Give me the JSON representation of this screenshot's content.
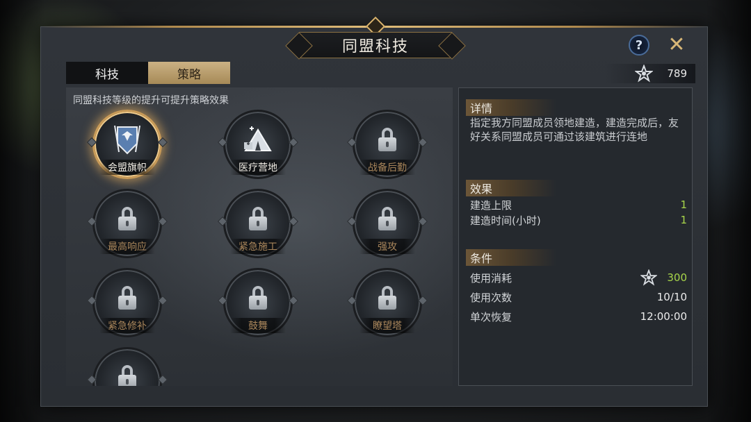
{
  "title": "同盟科技",
  "tabs": [
    {
      "label": "科技",
      "active": false
    },
    {
      "label": "策略",
      "active": true
    }
  ],
  "currency": {
    "icon": "alliance-star-icon",
    "amount": "789"
  },
  "hint": "同盟科技等级的提升可提升策略效果",
  "nodes": [
    {
      "label": "会盟旗帜",
      "state": "selected",
      "icon": "alliance-banner-icon"
    },
    {
      "label": "医疗营地",
      "state": "unlocked",
      "icon": "medical-camp-icon"
    },
    {
      "label": "战备后勤",
      "state": "locked",
      "icon": "lock-icon"
    },
    {
      "label": "最高响应",
      "state": "locked",
      "icon": "lock-icon"
    },
    {
      "label": "紧急施工",
      "state": "locked",
      "icon": "lock-icon"
    },
    {
      "label": "强攻",
      "state": "locked",
      "icon": "lock-icon"
    },
    {
      "label": "紧急修补",
      "state": "locked",
      "icon": "lock-icon"
    },
    {
      "label": "鼓舞",
      "state": "locked",
      "icon": "lock-icon"
    },
    {
      "label": "瞭望塔",
      "state": "locked",
      "icon": "lock-icon"
    },
    {
      "label": "",
      "state": "locked",
      "icon": "lock-icon"
    }
  ],
  "detail": {
    "details_title": "详情",
    "description": "指定我方同盟成员领地建造，建造完成后，友好关系同盟成员可通过该建筑进行连地",
    "effects_title": "效果",
    "effects": [
      {
        "label": "建造上限",
        "value": "1"
      },
      {
        "label": "建造时间(小时)",
        "value": "1"
      }
    ],
    "conditions_title": "条件",
    "conditions": [
      {
        "label": "使用消耗",
        "value": "300"
      },
      {
        "label": "使用次数",
        "value": "10/10"
      },
      {
        "label": "单次恢复",
        "value": "12:00:00"
      }
    ]
  },
  "colors": {
    "accent_gold": "#c99b58",
    "value_green": "#a8d64a",
    "locked_label": "#a9865b"
  }
}
